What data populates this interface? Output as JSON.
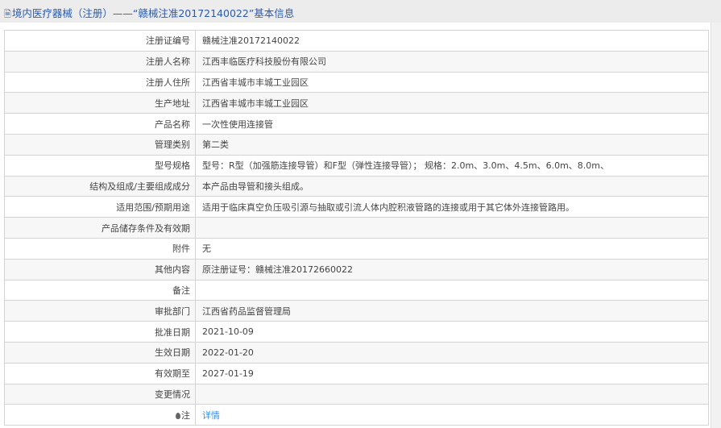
{
  "header": {
    "icon": "document-icon",
    "title": "境内医疗器械（注册）——“赣械注准20172140022”基本信息"
  },
  "rows": [
    {
      "label": "注册证编号",
      "value": "赣械注准20172140022"
    },
    {
      "label": "注册人名称",
      "value": "江西丰临医疗科技股份有限公司"
    },
    {
      "label": "注册人住所",
      "value": "江西省丰城市丰城工业园区"
    },
    {
      "label": "生产地址",
      "value": "江西省丰城市丰城工业园区"
    },
    {
      "label": "产品名称",
      "value": "一次性使用连接管"
    },
    {
      "label": "管理类别",
      "value": "第二类"
    },
    {
      "label": "型号规格",
      "value": "型号：R型（加强筋连接导管）和F型（弹性连接导管）；  规格：2.0m、3.0m、4.5m、6.0m、8.0m、"
    },
    {
      "label": "结构及组成/主要组成成分",
      "value": "本产品由导管和接头组成。"
    },
    {
      "label": "适用范围/预期用途",
      "value": "适用于临床真空负压吸引源与抽取或引流人体内腔积液管路的连接或用于其它体外连接管路用。"
    },
    {
      "label": "产品储存条件及有效期",
      "value": ""
    },
    {
      "label": "附件",
      "value": "无"
    },
    {
      "label": "其他内容",
      "value": "原注册证号：赣械注准20172660022"
    },
    {
      "label": "备注",
      "value": ""
    },
    {
      "label": "审批部门",
      "value": "江西省药品监督管理局"
    },
    {
      "label": "批准日期",
      "value": "2021-10-09"
    },
    {
      "label": "生效日期",
      "value": "2022-01-20"
    },
    {
      "label": "有效期至",
      "value": "2027-01-19"
    },
    {
      "label": "变更情况",
      "value": ""
    }
  ],
  "note": {
    "label": "注",
    "link": "详情"
  }
}
